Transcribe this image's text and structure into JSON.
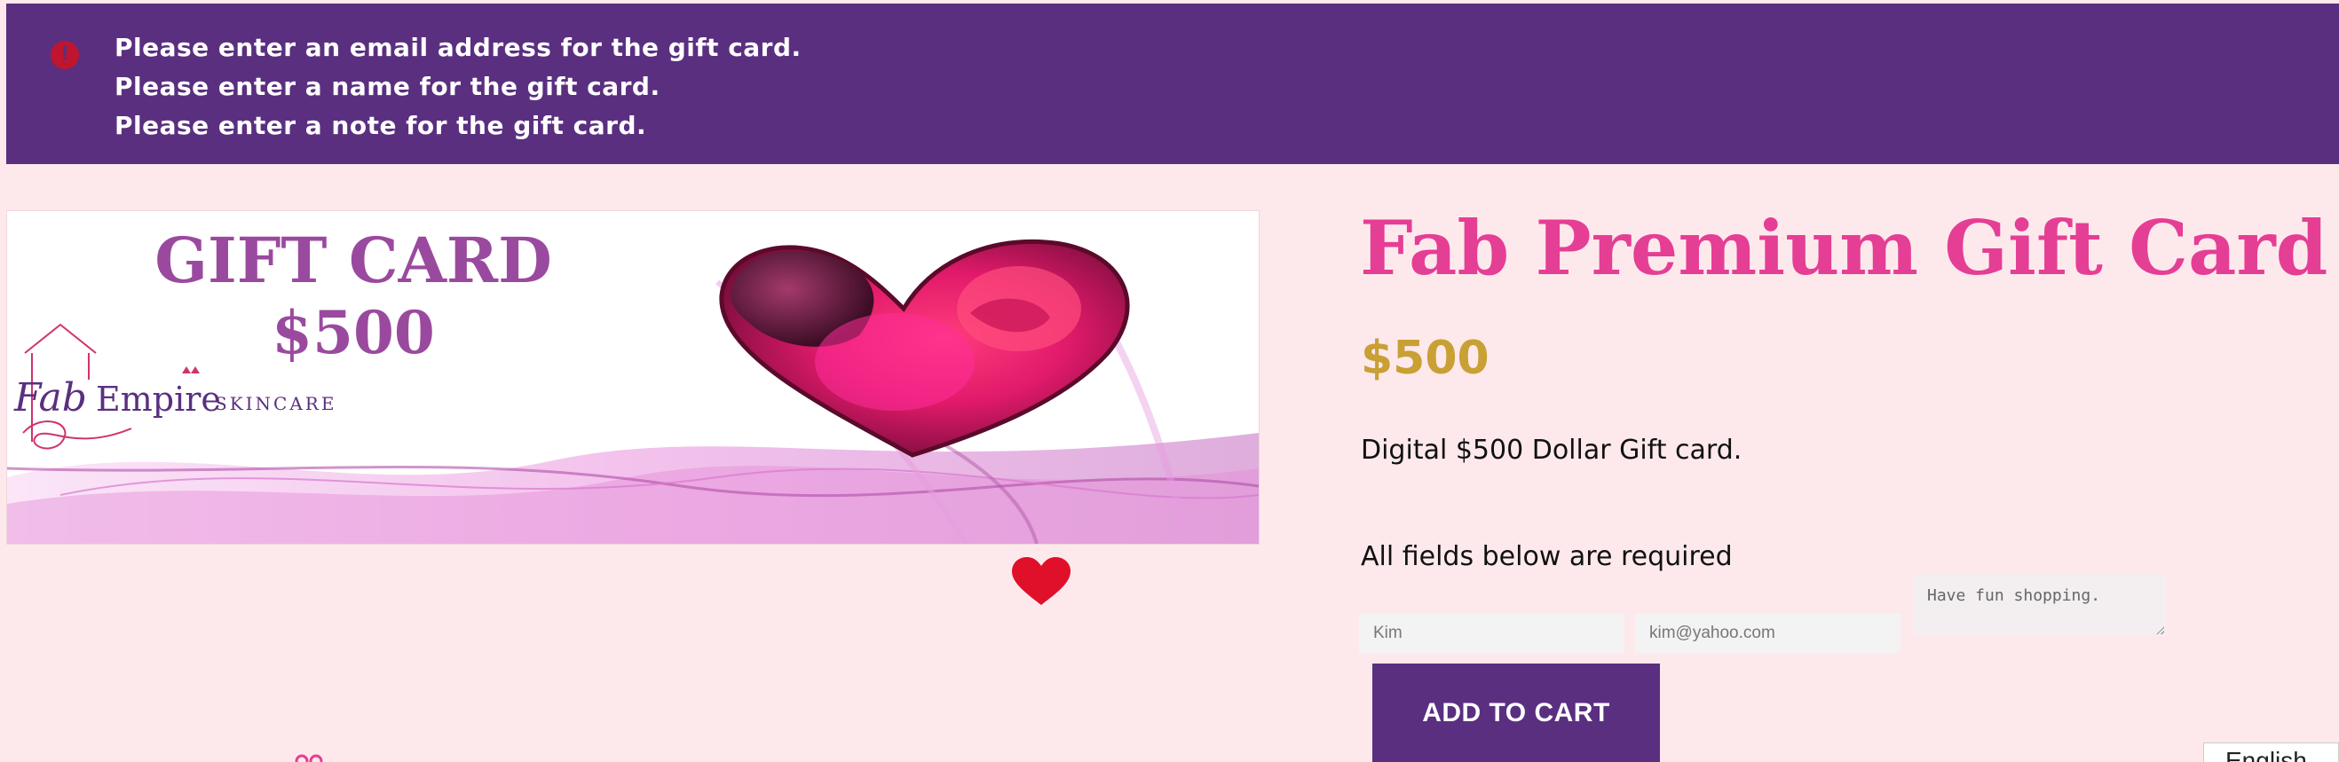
{
  "error_banner": {
    "icon": "error-circle-icon",
    "messages": [
      "Please enter an email address for the gift card.",
      "Please enter a name for the gift card.",
      "Please enter a note for the gift card."
    ]
  },
  "product": {
    "image": {
      "heading": "GIFT CARD",
      "amount": "$500",
      "brand_script": "Fab",
      "brand_name": "Empire",
      "brand_suffix": "SKINCARE"
    },
    "title": "Fab Premium Gift Card",
    "price": "$500",
    "description": "Digital $500 Dollar Gift card.",
    "required_note": "All fields below are required"
  },
  "form": {
    "name_value": "Kim",
    "email_value": "kim@yahoo.com",
    "note_value": "Have fun shopping.",
    "add_to_cart_label": "ADD TO CART"
  },
  "language_switcher": {
    "label": "English"
  },
  "colors": {
    "page_background": "#fde9ec",
    "banner": "#5a2f80",
    "title": "#e53e95",
    "price": "#c8a034",
    "heart": "#e0102a"
  }
}
